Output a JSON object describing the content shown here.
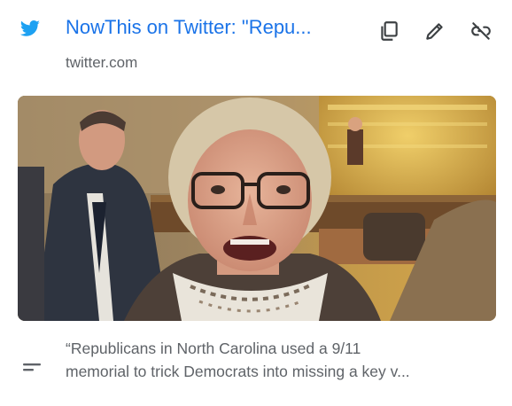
{
  "link_card": {
    "title": "NowThis on Twitter: \"Repu...",
    "domain": "twitter.com",
    "favicon": "twitter-bird-icon",
    "actions": [
      {
        "name": "copy-link",
        "icon": "copy-icon"
      },
      {
        "name": "edit-link",
        "icon": "pencil-icon"
      },
      {
        "name": "unlink",
        "icon": "link-off-icon"
      }
    ],
    "description_lines": [
      "“Republicans in North Carolina used a 9/11",
      "memorial to trick Democrats into missing a key v..."
    ],
    "description_icon": "short-text-icon"
  },
  "colors": {
    "title": "#1a73e8",
    "secondary_text": "#5f6368",
    "icon": "#3c4043",
    "twitter_blue": "#1da1f2"
  }
}
